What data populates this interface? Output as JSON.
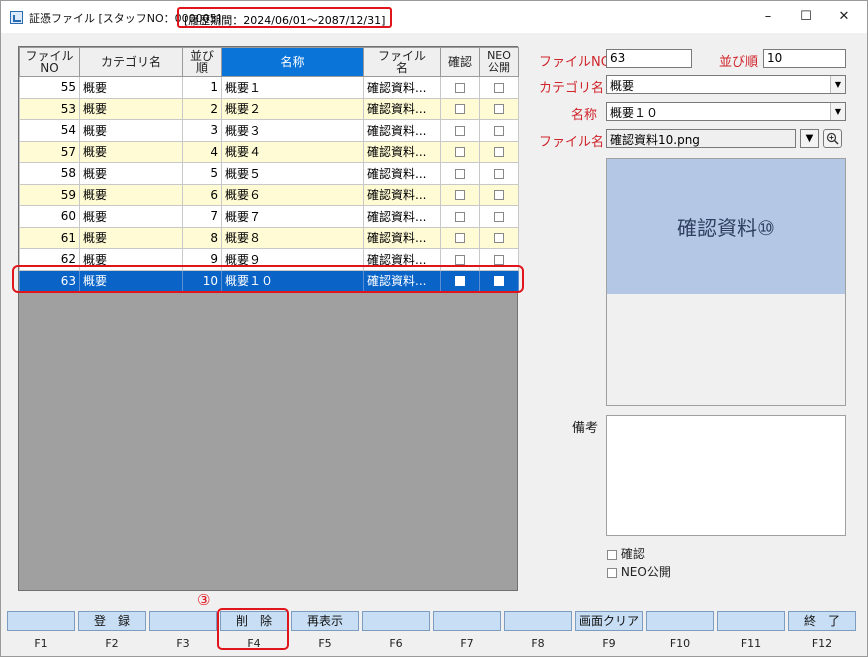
{
  "titlebar": {
    "title": "証憑ファイル [スタッフNO：000005]",
    "period": "[履歴期間：2024/06/01～2087/12/31]",
    "minimize": "–",
    "maximize": "☐",
    "close": "✕"
  },
  "grid": {
    "headers": {
      "file_no": "ファイル\nNO",
      "category": "カテゴリ名",
      "order": "並び\n順",
      "name": "名称",
      "file_name": "ファイル\n名",
      "confirm": "確認",
      "neo": "NEO\n公開"
    },
    "rows": [
      {
        "file_no": "55",
        "category": "概要",
        "order": "1",
        "name": "概要１",
        "file": "確認資料..."
      },
      {
        "file_no": "53",
        "category": "概要",
        "order": "2",
        "name": "概要２",
        "file": "確認資料..."
      },
      {
        "file_no": "54",
        "category": "概要",
        "order": "3",
        "name": "概要３",
        "file": "確認資料..."
      },
      {
        "file_no": "57",
        "category": "概要",
        "order": "4",
        "name": "概要４",
        "file": "確認資料..."
      },
      {
        "file_no": "58",
        "category": "概要",
        "order": "5",
        "name": "概要５",
        "file": "確認資料..."
      },
      {
        "file_no": "59",
        "category": "概要",
        "order": "6",
        "name": "概要６",
        "file": "確認資料..."
      },
      {
        "file_no": "60",
        "category": "概要",
        "order": "7",
        "name": "概要７",
        "file": "確認資料..."
      },
      {
        "file_no": "61",
        "category": "概要",
        "order": "8",
        "name": "概要８",
        "file": "確認資料..."
      },
      {
        "file_no": "62",
        "category": "概要",
        "order": "9",
        "name": "概要９",
        "file": "確認資料..."
      },
      {
        "file_no": "63",
        "category": "概要",
        "order": "10",
        "name": "概要１０",
        "file": "確認資料..."
      }
    ],
    "selected_index": 9
  },
  "form": {
    "file_no_label": "ファイルNO",
    "file_no_value": "63",
    "order_label": "並び順",
    "order_value": "10",
    "category_label": "カテゴリ名",
    "category_value": "概要",
    "name_label": "名称",
    "name_value": "概要１０",
    "file_name_label": "ファイル名",
    "file_name_value": "確認資料10.png",
    "preview_text": "確認資料⑩",
    "memo_label": "備考",
    "confirm_label": "確認",
    "neo_label": "NEO公開"
  },
  "fkeys": {
    "marker": "③",
    "buttons": [
      {
        "label": "",
        "key": "F1"
      },
      {
        "label": "登　録",
        "key": "F2"
      },
      {
        "label": "",
        "key": "F3"
      },
      {
        "label": "削　除",
        "key": "F4"
      },
      {
        "label": "再表示",
        "key": "F5"
      },
      {
        "label": "",
        "key": "F6"
      },
      {
        "label": "",
        "key": "F7"
      },
      {
        "label": "",
        "key": "F8"
      },
      {
        "label": "画面クリア",
        "key": "F9"
      },
      {
        "label": "",
        "key": "F10"
      },
      {
        "label": "",
        "key": "F11"
      },
      {
        "label": "終　了",
        "key": "F12"
      }
    ]
  },
  "colors": {
    "accent_red": "#e0151c",
    "selected_row": "#0a64c8",
    "header_name": "#0a74d8",
    "alt_row": "#fffbd5",
    "fkey_bg": "#c8def4",
    "preview_bg": "#b4c8e6"
  }
}
